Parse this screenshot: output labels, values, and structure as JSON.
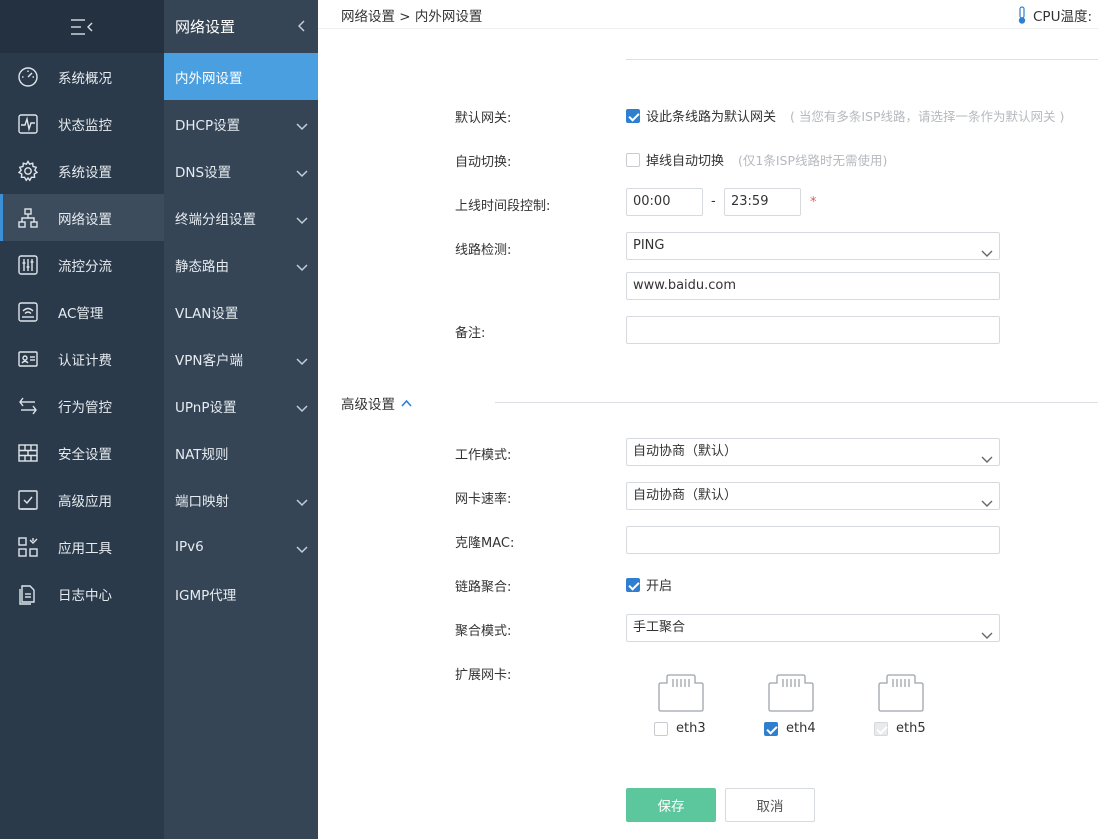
{
  "nav1": {
    "items": [
      {
        "label": "系统概况",
        "icon": "gauge-icon"
      },
      {
        "label": "状态监控",
        "icon": "pulse-monitor-icon"
      },
      {
        "label": "系统设置",
        "icon": "gear-icon"
      },
      {
        "label": "网络设置",
        "icon": "network-tree-icon"
      },
      {
        "label": "流控分流",
        "icon": "sliders-icon"
      },
      {
        "label": "AC管理",
        "icon": "wifi-router-icon"
      },
      {
        "label": "认证计费",
        "icon": "id-card-icon"
      },
      {
        "label": "行为管控",
        "icon": "swap-arrows-icon"
      },
      {
        "label": "安全设置",
        "icon": "firewall-icon"
      },
      {
        "label": "高级应用",
        "icon": "checked-document-icon"
      },
      {
        "label": "应用工具",
        "icon": "tools-grid-icon"
      },
      {
        "label": "日志中心",
        "icon": "log-files-icon"
      }
    ],
    "active_index": 3
  },
  "nav2": {
    "title": "网络设置",
    "items": [
      {
        "label": "内外网设置",
        "expandable": false
      },
      {
        "label": "DHCP设置",
        "expandable": true
      },
      {
        "label": "DNS设置",
        "expandable": true
      },
      {
        "label": "终端分组设置",
        "expandable": true
      },
      {
        "label": "静态路由",
        "expandable": true
      },
      {
        "label": "VLAN设置",
        "expandable": false
      },
      {
        "label": "VPN客户端",
        "expandable": true
      },
      {
        "label": "UPnP设置",
        "expandable": true
      },
      {
        "label": "NAT规则",
        "expandable": false
      },
      {
        "label": "端口映射",
        "expandable": true
      },
      {
        "label": "IPv6",
        "expandable": true
      },
      {
        "label": "IGMP代理",
        "expandable": false
      }
    ],
    "active_index": 0
  },
  "header": {
    "breadcrumb": "网络设置 > 内外网设置",
    "cpu_label": "CPU温度:"
  },
  "form": {
    "default_gateway": {
      "label": "默认网关:",
      "checkbox_text": "设此条线路为默认网关",
      "hint": "( 当您有多条ISP线路，请选择一条作为默认网关 )",
      "checked": true
    },
    "auto_switch": {
      "label": "自动切换:",
      "checkbox_text": "掉线自动切换",
      "hint": "(仅1条ISP线路时无需使用)",
      "checked": false
    },
    "online_time": {
      "label": "上线时间段控制:",
      "start": "00:00",
      "separator": "-",
      "end": "23:59",
      "required_mark": "*"
    },
    "line_detect": {
      "label": "线路检测:",
      "method": "PING",
      "target": "www.baidu.com"
    },
    "remark": {
      "label": "备注:",
      "value": ""
    }
  },
  "advanced": {
    "title": "高级设置",
    "work_mode": {
      "label": "工作模式:",
      "value": "自动协商（默认）"
    },
    "nic_speed": {
      "label": "网卡速率:",
      "value": "自动协商（默认）"
    },
    "clone_mac": {
      "label": "克隆MAC:",
      "value": ""
    },
    "link_agg": {
      "label": "链路聚合:",
      "checkbox_text": "开启",
      "checked": true
    },
    "agg_mode": {
      "label": "聚合模式:",
      "value": "手工聚合"
    },
    "ext_nic": {
      "label": "扩展网卡:",
      "ports": [
        {
          "name": "eth3",
          "state": "unchecked"
        },
        {
          "name": "eth4",
          "state": "checked"
        },
        {
          "name": "eth5",
          "state": "disabled-checked"
        }
      ]
    }
  },
  "buttons": {
    "save": "保存",
    "cancel": "取消"
  },
  "colors": {
    "sidebar": "#2b3a4a",
    "subnav": "#354556",
    "active_blue": "#4a9fe0",
    "save_green": "#5cc79c",
    "checkbox_blue": "#2f7fd1"
  }
}
